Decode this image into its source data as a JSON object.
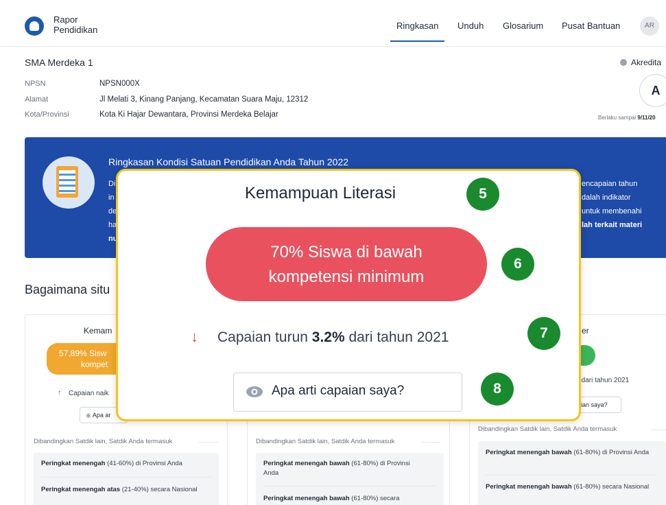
{
  "header": {
    "brand_line1": "Rapor",
    "brand_line2": "Pendidikan",
    "nav": [
      "Ringkasan",
      "Unduh",
      "Glosarium",
      "Pusat Bantuan"
    ],
    "active_nav": "Ringkasan",
    "avatar_initials": "AR",
    "accent_color": "#1e5aa8"
  },
  "school": {
    "name": "SMA Merdeka 1",
    "labels": [
      "NPSN",
      "Alamat",
      "Kota/Provinsi"
    ],
    "values": [
      "NPSN000X",
      "Jl Melati 3, Kinang Panjang, Kecamatan Suara Maju, 12312",
      "Kota Ki Hajar Dewantara, Provinsi Merdeka Belajar"
    ],
    "accreditation_label": "Akredita",
    "accreditation_grade": "A",
    "valid_prefix": "Berlaku sampai",
    "valid_date": "9/11/20"
  },
  "banner": {
    "title": "Ringkasan Kondisi Satuan Pendidikan Anda Tahun 2022",
    "left_fragments": [
      "Di",
      "in",
      "de",
      "ha",
      "nu"
    ],
    "right_fragments": [
      "encapaian tahun",
      "dalah indikator",
      "untuk membenahi",
      "lah terkait materi"
    ],
    "background_color": "#1e4aa8"
  },
  "section": {
    "title": "Bagaimana situ"
  },
  "cards": {
    "left": {
      "title": "Kemam",
      "pill_line1": "57,89% Sisw",
      "pill_line2": "kompet",
      "pill_color": "#f0a830",
      "trend": "Capaian naik",
      "trend_arrow": "↑",
      "button": "Apa ar",
      "compare": "Dibandingkan Satdik lain, Satdik Anda termasuk",
      "rank1_bold": "Peringkat menengah",
      "rank1_rest": " (41-60%) di Provinsi Anda",
      "rank2_bold": "Peringkat menengah atas",
      "rank2_rest": " (21-40%) secara Nasional"
    },
    "middle": {
      "compare": "Dibandingkan Satdik lain, Satdik Anda termasuk",
      "rank1_bold": "Peringkat menengah bawah",
      "rank1_rest": " (61-80%) di Provinsi Anda",
      "rank2_bold": "Peringkat menengah bawah",
      "rank2_rest": " (61-80%) secara"
    },
    "right": {
      "title": "er",
      "pill_color": "#3cb55a",
      "trend": "% dari tahun 2021",
      "button": "ian saya?",
      "compare": "Dibandingkan Satdik lain, Satdik Anda termasuk",
      "rank1_bold": "Peringkat menengah bawah",
      "rank1_rest": " (61-80%) di Provinsi Anda",
      "rank2_bold": "Peringkat menengah bawah",
      "rank2_rest": " (61-80%) secara Nasional"
    }
  },
  "popup": {
    "title": "Kemampuan Literasi",
    "badge_title": "5",
    "pill_line1": "70% Siswa di bawah",
    "pill_line2": "kompetensi minimum",
    "badge_pill": "6",
    "trend_arrow": "↓",
    "trend_prefix": "Capaian turun ",
    "trend_value": "3.2%",
    "trend_suffix": " dari tahun 2021",
    "badge_trend": "7",
    "button": "Apa arti capaian saya?",
    "badge_button": "8",
    "border_color": "#f5c518",
    "pill_color": "#e9515f",
    "badge_color": "#1a8a2e"
  }
}
